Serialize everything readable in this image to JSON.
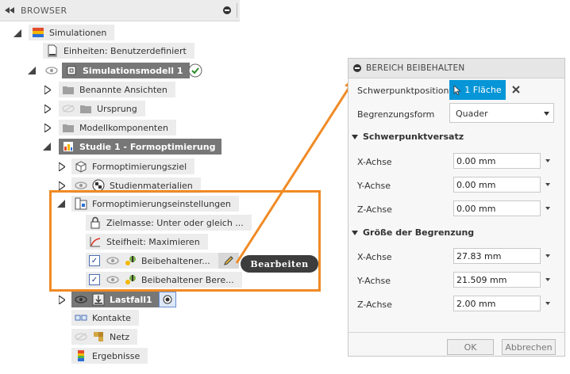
{
  "browser": {
    "title": "BROWSER",
    "tree": {
      "simulationen": "Simulationen",
      "einheiten": "Einheiten: Benutzerdefiniert",
      "simulationsmodell": "Simulationsmodell 1",
      "benannte_ansichten": "Benannte Ansichten",
      "ursprung": "Ursprung",
      "modellkomponenten": "Modellkomponenten",
      "studie": "Studie 1 - Formoptimierung",
      "formoptimierungsziel": "Formoptimierungsziel",
      "studienmaterialien": "Studienmaterialien",
      "formoptimierungseinstellungen": "Formoptimierungseinstellungen",
      "zielmasse": "Zielmasse: Unter oder gleich ...",
      "steifheit": "Steifheit: Maximieren",
      "beibehaltener1": "Beibehaltener...",
      "beibehaltener2": "Beibehaltener Bere...",
      "lastfall": "Lastfall1",
      "kontakte": "Kontakte",
      "netz": "Netz",
      "ergebnisse": "Ergebnisse"
    }
  },
  "tooltip": {
    "text": "Bearbeiten"
  },
  "panel": {
    "title": "BEREICH BEIBEHALTEN",
    "schwerpunktposition_label": "Schwerpunktposition",
    "schwerpunktposition_button": "1 Fläche",
    "begrenzungsform_label": "Begrenzungsform",
    "begrenzungsform_value": "Quader",
    "section1": "Schwerpunktversatz",
    "versatz": [
      {
        "label": "X-Achse",
        "value": "0.00 mm"
      },
      {
        "label": "Y-Achse",
        "value": "0.00 mm"
      },
      {
        "label": "Z-Achse",
        "value": "0.00 mm"
      }
    ],
    "section2": "Größe der Begrenzung",
    "groesse": [
      {
        "label": "X-Achse",
        "value": "27.83 mm"
      },
      {
        "label": "Y-Achse",
        "value": "21.509 mm"
      },
      {
        "label": "Z-Achse",
        "value": "2.00 mm"
      }
    ],
    "ok": "OK",
    "abbrechen": "Abbrechen"
  },
  "colors": {
    "accent": "#0696d7",
    "highlight": "#f08a24",
    "dark_node": "#777777"
  }
}
